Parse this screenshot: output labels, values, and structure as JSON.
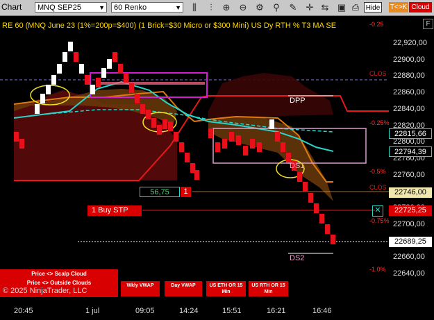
{
  "toolbar": {
    "title": "Chart",
    "instrument": "MNQ SEP25",
    "interval": "60 Renko",
    "hide_label": "Hide",
    "tk_label": "T<>K",
    "cloud_label": "Cloud"
  },
  "chart_header": "RE 60 (MNQ June 23 (1%=200p=$400) (1 Brick=$30 Micro or $300 Mini) US Dy RTH % T3 MA SE",
  "f_button": "F",
  "price_axis": [
    "22,920,00",
    "22900,00",
    "22880,00",
    "22860,00",
    "22840,00",
    "22820,00",
    "22800,00",
    "22780,00",
    "22760,00",
    "22740,00",
    "22720,00",
    "22700,00",
    "22680,00",
    "22660,00",
    "22640,00"
  ],
  "price_tags": {
    "tag1": "22815,66",
    "tag2": "22794,39",
    "tag3": "22746,00",
    "tag4": "22725,25",
    "tag5": "22689,25"
  },
  "pct_labels": [
    "-0.25",
    "-0.25%",
    "-0.5%",
    "-0.75%",
    "-1.0%"
  ],
  "level_labels": {
    "clos1": "CLOS",
    "clos2": "CLOS",
    "dpp": "DPP",
    "ds1": "DS1",
    "ds2": "DS2"
  },
  "order": {
    "buy_stp": "1 Buy STP",
    "value": "56,75",
    "qty": "1",
    "cancel": "✕"
  },
  "time_axis": [
    "20:45",
    "1 jul",
    "09:05",
    "14:24",
    "15:51",
    "16:21",
    "16:46"
  ],
  "buttons": {
    "scalp_cloud": "Price <> Scalp Cloud",
    "outside_clouds": "Price <> Outside Clouds",
    "wkly_vwap": "Wkly VWAP",
    "day_vwap": "Day VWAP",
    "us_eth": "US ETH OR 15 Min",
    "us_rth": "US RTH OR 15 Min"
  },
  "copyright": "© 2025 NinjaTrader, LLC",
  "colors": {
    "bull": "#ffffff",
    "bear": "#e8101a",
    "cyan": "#2bd4c8",
    "orange": "#e07a10",
    "magenta": "#d21ed2"
  }
}
